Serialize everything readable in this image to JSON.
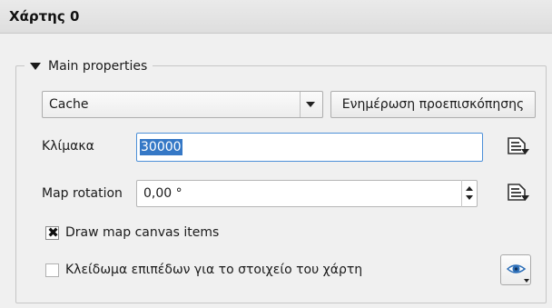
{
  "panel": {
    "title": "Χάρτης 0"
  },
  "group": {
    "title": "Main properties"
  },
  "cache_combo": {
    "value": "Cache"
  },
  "preview_button": {
    "label": "Ενημέρωση προεπισκόπησης"
  },
  "scale": {
    "label": "Κλίμακα",
    "value": "30000"
  },
  "map_rotation": {
    "label": "Map rotation",
    "value": "0,00 °"
  },
  "draw_items": {
    "label": "Draw map canvas items",
    "checked": true,
    "check_glyph": "✖"
  },
  "lock_layers": {
    "label": "Κλείδωμα επιπέδων για το στοιχείο του χάρτη",
    "checked": false
  },
  "icons": {
    "data_defined": "data-defined-override-icon",
    "visibility": "eye-icon"
  },
  "colors": {
    "selection": "#3578c6",
    "focus_border": "#4d90d8"
  }
}
